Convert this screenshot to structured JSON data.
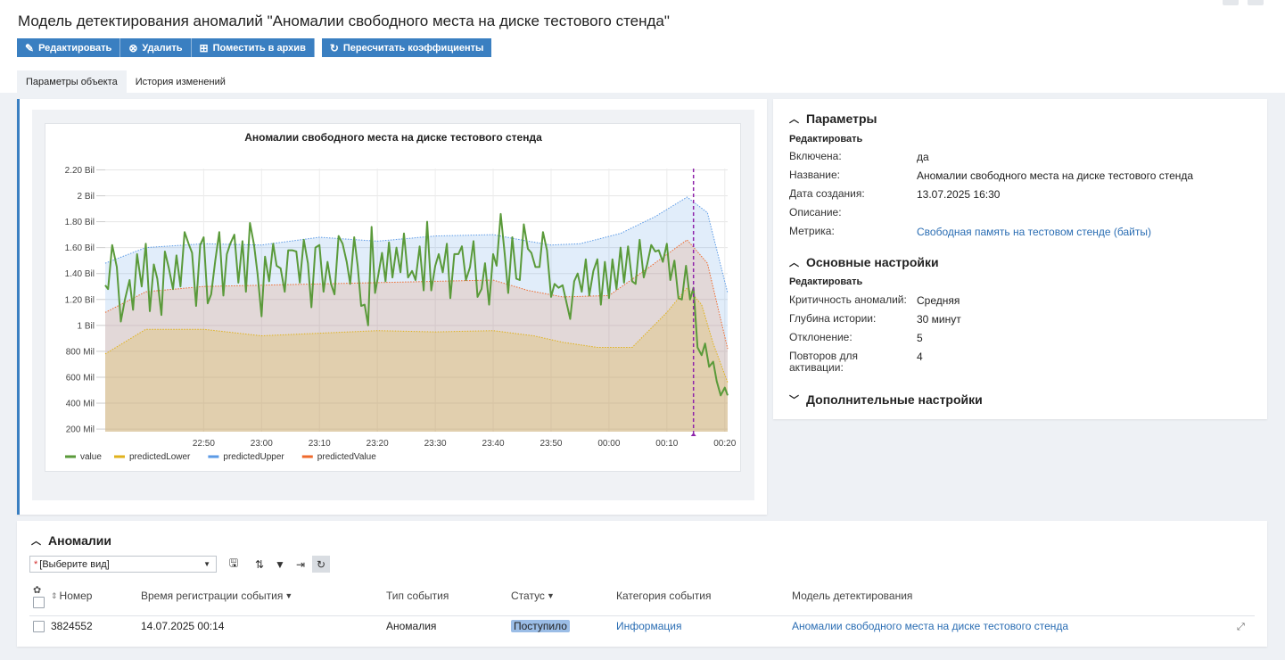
{
  "page": {
    "title": "Модель детектирования аномалий \"Аномалии свободного места на диске тестового стенда\""
  },
  "toolbar": {
    "edit": "Редактировать",
    "delete": "Удалить",
    "archive": "Поместить в архив",
    "recalc": "Пересчитать коэффициенты"
  },
  "tabs": [
    "Параметры объекта",
    "История изменений"
  ],
  "parameters": {
    "header": "Параметры",
    "edit": "Редактировать",
    "rows": [
      {
        "label": "Включена:",
        "value": "да"
      },
      {
        "label": "Название:",
        "value": "Аномалии свободного места на диске тестового стенда"
      },
      {
        "label": "Дата создания:",
        "value": "13.07.2025  16:30"
      },
      {
        "label": "Описание:",
        "value": ""
      },
      {
        "label": "Метрика:",
        "value": "Свободная память на тестовом стенде (байты)"
      }
    ]
  },
  "basic_settings": {
    "header": "Основные настройки",
    "edit": "Редактировать",
    "rows": [
      {
        "label": "Критичность аномалий:",
        "value": "Средняя"
      },
      {
        "label": "Глубина истории:",
        "value": "30 минут"
      },
      {
        "label": "Отклонение:",
        "value": "5"
      },
      {
        "label": "Повторов для активации:",
        "value": "4"
      }
    ]
  },
  "extra_settings": {
    "header": "Дополнительные настройки"
  },
  "anomalies": {
    "header": "Аномалии",
    "view_select": "[Выберите вид]",
    "columns": [
      "Номер",
      "Время регистрации события",
      "Тип события",
      "Статус",
      "Категория события",
      "Модель детектирования"
    ],
    "rows": [
      {
        "number": "3824552",
        "time": "14.07.2025  00:14",
        "type": "Аномалия",
        "status": "Поступило",
        "category": "Информация",
        "model": "Аномалии свободного места на диске тестового стенда"
      }
    ]
  },
  "colors": {
    "accent": "#3a7fc1",
    "value": "#5a9a3a",
    "predictedLower": "#e0b21c",
    "predictedUpper": "#5b9ae6",
    "predictedValue": "#ef6a2c",
    "marker": "#8e24aa"
  },
  "chart_data": {
    "type": "area",
    "title": "Аномалии свободного места на диске тестового стенда",
    "y_tick_labels": [
      "200 Mil",
      "400 Mil",
      "600 Mil",
      "800 Mil",
      "1 Bil",
      "1.20 Bil",
      "1.40 Bil",
      "1.60 Bil",
      "1.80 Bil",
      "2 Bil",
      "2.20 Bil"
    ],
    "y_ticks": [
      200000000,
      400000000,
      600000000,
      800000000,
      1000000000,
      1200000000,
      1400000000,
      1600000000,
      1800000000,
      2000000000,
      2200000000
    ],
    "ylim": [
      180000000,
      2210000000
    ],
    "x_tick_labels": [
      "22:50",
      "23:00",
      "23:10",
      "23:20",
      "23:30",
      "23:40",
      "23:50",
      "00:00",
      "00:10",
      "00:20"
    ],
    "x_tick_minutes": [
      10,
      20,
      30,
      40,
      50,
      60,
      70,
      80,
      90,
      100
    ],
    "x_range_minutes": [
      -7,
      100.5
    ],
    "x_origin": "22:40",
    "x_label_note": "",
    "anomaly_marker_minute": 94.6,
    "legend_position": "bottom-left",
    "series": [
      {
        "name": "value",
        "type": "line",
        "points": [
          [
            -7,
            1.31
          ],
          [
            -6.5,
            1.28
          ],
          [
            -5.8,
            1.62
          ],
          [
            -5,
            1.45
          ],
          [
            -4.3,
            1.03
          ],
          [
            -3.6,
            1.2
          ],
          [
            -2.8,
            1.35
          ],
          [
            -2.2,
            1.12
          ],
          [
            -1.5,
            1.55
          ],
          [
            -0.7,
            1.3
          ],
          [
            0,
            1.63
          ],
          [
            0.7,
            1.11
          ],
          [
            1.4,
            1.47
          ],
          [
            2,
            1.36
          ],
          [
            2.7,
            1.08
          ],
          [
            3.3,
            1.57
          ],
          [
            4,
            1.44
          ],
          [
            4.7,
            1.28
          ],
          [
            5.3,
            1.54
          ],
          [
            6,
            1.3
          ],
          [
            6.7,
            1.72
          ],
          [
            7.4,
            1.63
          ],
          [
            8,
            1.56
          ],
          [
            8.7,
            1.15
          ],
          [
            9.4,
            1.62
          ],
          [
            10,
            1.68
          ],
          [
            10.7,
            1.17
          ],
          [
            11.3,
            1.24
          ],
          [
            12,
            1.5
          ],
          [
            12.7,
            1.72
          ],
          [
            13.4,
            1.23
          ],
          [
            14,
            1.55
          ],
          [
            14.6,
            1.63
          ],
          [
            15.3,
            1.7
          ],
          [
            16,
            1.33
          ],
          [
            16.7,
            1.65
          ],
          [
            17.3,
            1.26
          ],
          [
            18,
            1.79
          ],
          [
            18.7,
            1.62
          ],
          [
            19.3,
            1.4
          ],
          [
            20,
            1.07
          ],
          [
            20.6,
            1.53
          ],
          [
            21.3,
            1.34
          ],
          [
            22,
            1.63
          ],
          [
            22.6,
            1.46
          ],
          [
            23.3,
            1.44
          ],
          [
            24,
            1.26
          ],
          [
            24.6,
            1.58
          ],
          [
            25.3,
            1.58
          ],
          [
            26,
            1.57
          ],
          [
            26.6,
            1.33
          ],
          [
            27.3,
            1.66
          ],
          [
            28,
            1.48
          ],
          [
            28.6,
            1.14
          ],
          [
            29.3,
            1.6
          ],
          [
            30,
            1.62
          ],
          [
            30.7,
            1.26
          ],
          [
            31.4,
            1.49
          ],
          [
            32,
            1.32
          ],
          [
            32.6,
            1.24
          ],
          [
            33.3,
            1.69
          ],
          [
            34,
            1.63
          ],
          [
            34.7,
            1.49
          ],
          [
            35.3,
            1.32
          ],
          [
            36,
            1.68
          ],
          [
            36.6,
            1.46
          ],
          [
            37.2,
            1.15
          ],
          [
            37.8,
            1.16
          ],
          [
            38.4,
            1.0
          ],
          [
            39,
            1.76
          ],
          [
            39.6,
            1.25
          ],
          [
            40.2,
            1.4
          ],
          [
            40.8,
            1.56
          ],
          [
            41.4,
            1.34
          ],
          [
            42,
            1.64
          ],
          [
            42.6,
            1.37
          ],
          [
            43.3,
            1.6
          ],
          [
            44,
            1.41
          ],
          [
            44.6,
            1.71
          ],
          [
            45.3,
            1.37
          ],
          [
            46,
            1.42
          ],
          [
            46.6,
            1.35
          ],
          [
            47.3,
            1.61
          ],
          [
            48,
            1.27
          ],
          [
            48.6,
            1.8
          ],
          [
            49.3,
            1.27
          ],
          [
            50,
            1.46
          ],
          [
            50.6,
            1.55
          ],
          [
            51.3,
            1.41
          ],
          [
            52,
            1.63
          ],
          [
            52.6,
            1.21
          ],
          [
            53.3,
            1.55
          ],
          [
            54,
            1.55
          ],
          [
            54.6,
            1.61
          ],
          [
            55.3,
            1.35
          ],
          [
            56,
            1.45
          ],
          [
            56.6,
            1.65
          ],
          [
            57.3,
            1.22
          ],
          [
            58,
            1.28
          ],
          [
            58.6,
            1.48
          ],
          [
            59.3,
            1.16
          ],
          [
            60,
            1.55
          ],
          [
            60.6,
            1.46
          ],
          [
            61.3,
            1.86
          ],
          [
            62,
            1.55
          ],
          [
            62.6,
            1.25
          ],
          [
            63.3,
            1.68
          ],
          [
            64,
            1.36
          ],
          [
            64.6,
            1.35
          ],
          [
            65.3,
            1.78
          ],
          [
            66,
            1.59
          ],
          [
            66.6,
            1.56
          ],
          [
            67.3,
            1.45
          ],
          [
            68,
            1.45
          ],
          [
            68.6,
            1.72
          ],
          [
            69.3,
            1.58
          ],
          [
            70,
            1.22
          ],
          [
            70.6,
            1.32
          ],
          [
            71.3,
            1.29
          ],
          [
            72,
            1.31
          ],
          [
            72.6,
            1.19
          ],
          [
            73.3,
            1.05
          ],
          [
            74,
            1.34
          ],
          [
            74.6,
            1.4
          ],
          [
            75.3,
            1.26
          ],
          [
            76,
            1.51
          ],
          [
            76.6,
            1.23
          ],
          [
            77.3,
            1.42
          ],
          [
            78,
            1.51
          ],
          [
            78.6,
            1.16
          ],
          [
            79.3,
            1.49
          ],
          [
            80,
            1.21
          ],
          [
            80.6,
            1.51
          ],
          [
            81.3,
            1.28
          ],
          [
            82,
            1.6
          ],
          [
            82.6,
            1.33
          ],
          [
            83.3,
            1.61
          ],
          [
            84,
            1.34
          ],
          [
            84.6,
            1.32
          ],
          [
            85.3,
            1.66
          ],
          [
            86,
            1.37
          ],
          [
            86.6,
            1.47
          ],
          [
            87.3,
            1.62
          ],
          [
            88,
            1.57
          ],
          [
            88.6,
            1.58
          ],
          [
            89.3,
            1.49
          ],
          [
            90,
            1.63
          ],
          [
            90.6,
            1.35
          ],
          [
            91.3,
            1.5
          ],
          [
            92,
            1.21
          ],
          [
            92.6,
            1.2
          ],
          [
            93.3,
            1.46
          ],
          [
            94,
            1.2
          ],
          [
            94.6,
            1.29
          ],
          [
            95.3,
            0.83
          ],
          [
            96,
            0.77
          ],
          [
            96.6,
            0.86
          ],
          [
            97.3,
            0.68
          ],
          [
            98,
            0.72
          ],
          [
            98.6,
            0.57
          ],
          [
            99.3,
            0.46
          ],
          [
            100,
            0.52
          ],
          [
            100.5,
            0.46
          ]
        ]
      },
      {
        "name": "predictedLower",
        "type": "area",
        "points": [
          [
            -7,
            0.78
          ],
          [
            0,
            0.97
          ],
          [
            10,
            0.97
          ],
          [
            20,
            0.92
          ],
          [
            30,
            0.94
          ],
          [
            40,
            0.96
          ],
          [
            50,
            0.95
          ],
          [
            60,
            0.96
          ],
          [
            67,
            0.92
          ],
          [
            72,
            0.87
          ],
          [
            78,
            0.83
          ],
          [
            84,
            0.83
          ],
          [
            90,
            1.1
          ],
          [
            93.5,
            1.29
          ],
          [
            96,
            1.16
          ],
          [
            98,
            0.86
          ],
          [
            100.5,
            0.56
          ]
        ]
      },
      {
        "name": "predictedUpper",
        "type": "area",
        "points": [
          [
            -7,
            1.48
          ],
          [
            0,
            1.6
          ],
          [
            10,
            1.63
          ],
          [
            20,
            1.62
          ],
          [
            30,
            1.68
          ],
          [
            40,
            1.65
          ],
          [
            50,
            1.69
          ],
          [
            60,
            1.7
          ],
          [
            66,
            1.65
          ],
          [
            70,
            1.62
          ],
          [
            75,
            1.63
          ],
          [
            82,
            1.71
          ],
          [
            88,
            1.84
          ],
          [
            93.5,
            1.99
          ],
          [
            97,
            1.87
          ],
          [
            100.5,
            1.25
          ]
        ]
      },
      {
        "name": "predictedValue",
        "type": "area",
        "points": [
          [
            -7,
            1.1
          ],
          [
            0,
            1.26
          ],
          [
            10,
            1.3
          ],
          [
            20,
            1.31
          ],
          [
            30,
            1.32
          ],
          [
            40,
            1.33
          ],
          [
            50,
            1.34
          ],
          [
            60,
            1.35
          ],
          [
            66,
            1.27
          ],
          [
            72,
            1.22
          ],
          [
            80,
            1.23
          ],
          [
            87,
            1.45
          ],
          [
            93.5,
            1.66
          ],
          [
            97,
            1.48
          ],
          [
            100.5,
            0.82
          ]
        ]
      }
    ],
    "value_unit_note": "points y in Bil (×1e9)"
  }
}
